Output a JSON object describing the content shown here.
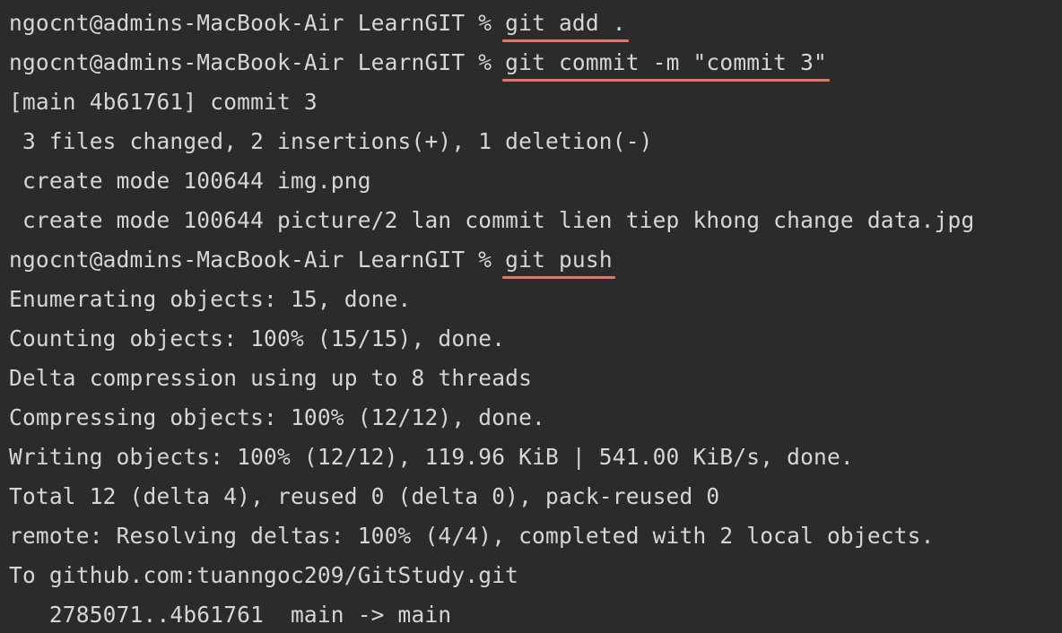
{
  "terminal": {
    "prompt": "ngocnt@admins-MacBook-Air LearnGIT % ",
    "accent_underline_color": "#e5736b",
    "background_color": "#2b2b2b",
    "text_color": "#d6d6d6",
    "commands": [
      "git add .",
      "git commit -m \"commit 3\"",
      "git push"
    ],
    "commit_output": [
      "[main 4b61761] commit 3",
      " 3 files changed, 2 insertions(+), 1 deletion(-)",
      " create mode 100644 img.png",
      " create mode 100644 picture/2 lan commit lien tiep khong change data.jpg"
    ],
    "push_output": [
      "Enumerating objects: 15, done.",
      "Counting objects: 100% (15/15), done.",
      "Delta compression using up to 8 threads",
      "Compressing objects: 100% (12/12), done.",
      "Writing objects: 100% (12/12), 119.96 KiB | 541.00 KiB/s, done.",
      "Total 12 (delta 4), reused 0 (delta 0), pack-reused 0",
      "remote: Resolving deltas: 100% (4/4), completed with 2 local objects.",
      "To github.com:tuanngoc209/GitStudy.git",
      "   2785071..4b61761  main -> main"
    ]
  }
}
